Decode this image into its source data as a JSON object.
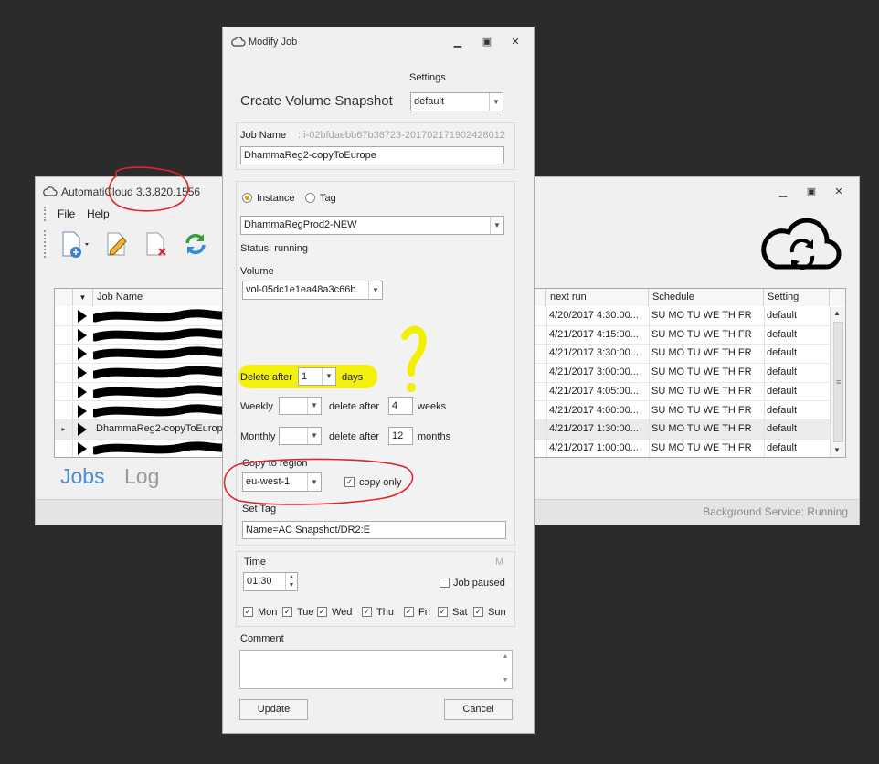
{
  "main_window": {
    "title": "AutomatiCloud 3.3.820.1556",
    "menu": [
      "File",
      "Help"
    ],
    "columns": [
      "Job Name",
      "next run",
      "Schedule",
      "Setting"
    ],
    "rows": [
      {
        "name": "",
        "next_run": "4/20/2017 4:30:00...",
        "schedule": "SU MO TU WE TH FR",
        "setting": "default"
      },
      {
        "name": "",
        "next_run": "4/21/2017 4:15:00...",
        "schedule": "SU MO TU WE TH FR",
        "setting": "default"
      },
      {
        "name": "",
        "next_run": "4/21/2017 3:30:00...",
        "schedule": "SU MO TU WE TH FR",
        "setting": "default"
      },
      {
        "name": "",
        "next_run": "4/21/2017 3:00:00...",
        "schedule": "SU MO TU WE TH FR",
        "setting": "default"
      },
      {
        "name": "",
        "next_run": "4/21/2017 4:05:00...",
        "schedule": "SU MO TU WE TH FR",
        "setting": "default"
      },
      {
        "name": "",
        "next_run": "4/21/2017 4:00:00...",
        "schedule": "SU MO TU WE TH FR",
        "setting": "default"
      },
      {
        "name": "DhammaReg2-copyToEurope",
        "next_run": "4/21/2017 1:30:00...",
        "schedule": "SU MO TU WE TH FR",
        "setting": "default"
      },
      {
        "name": "",
        "next_run": "4/21/2017 1:00:00...",
        "schedule": "SU MO TU WE TH FR",
        "setting": "default"
      }
    ],
    "tabs": [
      "Jobs",
      "Log"
    ],
    "status": "Background Service: Running"
  },
  "dialog": {
    "title": "Modify Job",
    "heading": "Create Volume Snapshot",
    "settings_label": "Settings",
    "settings_value": "default",
    "job_name_label": "Job Name",
    "job_id": ": i-02bfdaebb67b36723-20170217190242801​2",
    "job_name_value": "DhammaReg2-copyToEurope",
    "instance_label": "Instance",
    "tag_label": "Tag",
    "instance_value": "DhammaRegProd2-NEW",
    "status_text": "Status: running",
    "volume_label": "Volume",
    "volume_value": "vol-05dc1e1ea48a3c66b",
    "delete_after_label": "Delete after",
    "delete_after_value": "1",
    "days_label": "days",
    "weekly_label": "Weekly",
    "weekly_delete_label": "delete after",
    "weekly_value": "4",
    "weeks_label": "weeks",
    "monthly_label": "Monthly",
    "monthly_delete_label": "delete after",
    "monthly_value": "12",
    "months_label": "months",
    "copy_region_label": "Copy to region",
    "region_value": "eu-west-1",
    "copy_only_label": "copy only",
    "set_tag_label": "Set Tag",
    "set_tag_value": "Name=AC Snapshot/DR2:E",
    "time_label": "Time",
    "m_label": "M",
    "time_value": "01:30",
    "job_paused_label": "Job paused",
    "days": [
      "Mon",
      "Tue",
      "Wed",
      "Thu",
      "Fri",
      "Sat",
      "Sun"
    ],
    "comment_label": "Comment",
    "update_label": "Update",
    "cancel_label": "Cancel"
  },
  "annotations": {
    "question_mark": "?"
  },
  "colors": {
    "background": "#2b2b2b",
    "tab_active": "#4a8fd0",
    "highlight_yellow": "#f2ef00",
    "annotation_red": "#e0262b"
  }
}
